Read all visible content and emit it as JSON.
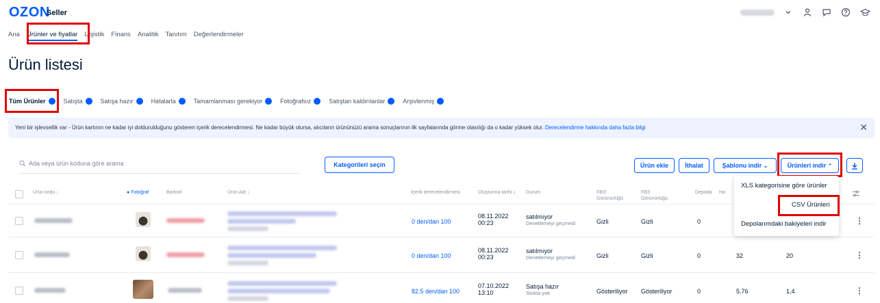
{
  "header": {
    "logo": "OZON",
    "logo_sub": "Seller"
  },
  "nav": {
    "items": [
      "Ana",
      "Ürünler ve fiyatlar",
      "Lojistik",
      "Finans",
      "Analitik",
      "Tanıtım",
      "Değerlendirmeler"
    ]
  },
  "page": {
    "title": "Ürün listesi"
  },
  "tabs": [
    "Tüm Ürünler",
    "Satışta",
    "Satışa hazır",
    "Hatalarla",
    "Tamamlanması gerekiyor",
    "Fotoğrafsız",
    "Satıştan kaldırılanlar",
    "Arşivlenmiş"
  ],
  "notice": {
    "text": "Yeni bir işlevsellik var - Ürün kartının ne kadar iyi doldurulduğunu gösteren içerik derecelendirmesi. Ne kadar büyük olursa, alıcıların ürününüzü arama sonuçlarının ilk sayfalarında görme olasılığı da o kadar yüksek olur. ",
    "link": "Derecelendirme hakkında daha fazla bilgi"
  },
  "toolbar": {
    "search_placeholder": "Ada veya ürün koduna göre arama",
    "categories_button": "Kategorileri seçin",
    "add_product": "Ürün ekle",
    "import": "İthalat",
    "download_template": "Şablonu indir",
    "download_products": "Ürünleri indir"
  },
  "dropdown": {
    "items": [
      "XLS kategorisine göre ürünler",
      "CSV Ürünleri",
      "Depolarımdaki bakiyeleri indir"
    ]
  },
  "table": {
    "headers": {
      "code": "Ürün kodu",
      "photo": "Fotoğraf",
      "barcode": "Barkod",
      "name": "Ürün Adı",
      "rating": "İçerik derecelendirmesi",
      "created": "Oluşturma tarihi",
      "status": "Durum",
      "fbo": "FBO Görünürlüğü",
      "fbs": "FBS Görünürlüğü",
      "warehouse": "Depoda",
      "ha": "Ha"
    },
    "rows": [
      {
        "rating": "0 den/dan 100",
        "date": "08.11.2022",
        "time": "00:23",
        "status": "satılmıyor",
        "status_sub": "Denetlemeyi geçmedi",
        "fbo": "Gizli",
        "fbs": "Gizli",
        "warehouse": "0",
        "c1": "",
        "c2": ""
      },
      {
        "rating": "0 den/dan 100",
        "date": "08.11.2022",
        "time": "00:23",
        "status": "satılmıyor",
        "status_sub": "Denetlemeyi geçmedi",
        "fbo": "Gizli",
        "fbs": "Gizli",
        "warehouse": "0",
        "c1": "32",
        "c2": "20"
      },
      {
        "rating": "82.5 den/dan 100",
        "date": "07.10.2022",
        "time": "13:10",
        "status": "Satışa hazır",
        "status_sub": "Stokta yok",
        "fbo": "Gösteriliyor",
        "fbs": "Gösteriliyor",
        "warehouse": "0",
        "c1": "5.76",
        "c2": "1,4"
      }
    ]
  },
  "colors": {
    "accent": "#005bff",
    "highlight": "#e00000"
  }
}
